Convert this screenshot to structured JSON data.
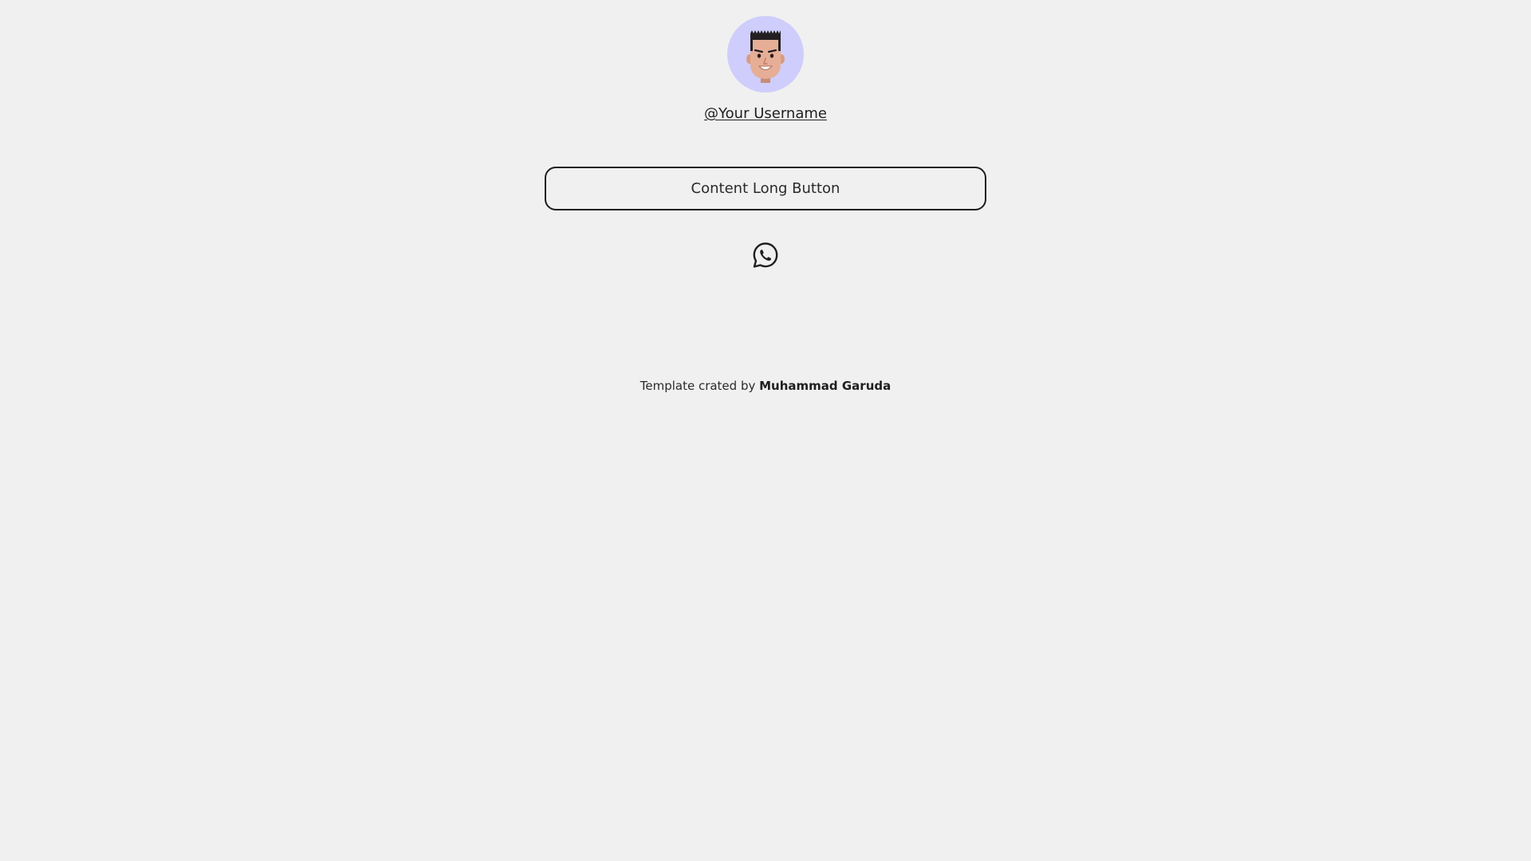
{
  "profile": {
    "username": "@Your Username",
    "avatar_icon": "cartoon-face-avatar",
    "avatar_bg": "#cfcdfb"
  },
  "buttons": [
    {
      "label": "Content Long Button"
    }
  ],
  "social": {
    "icon": "whatsapp-icon"
  },
  "footer": {
    "prefix": "Template crated by ",
    "author": "Muhammad Garuda"
  },
  "colors": {
    "background": "#f0f0f0",
    "text": "#1f1f1f"
  }
}
